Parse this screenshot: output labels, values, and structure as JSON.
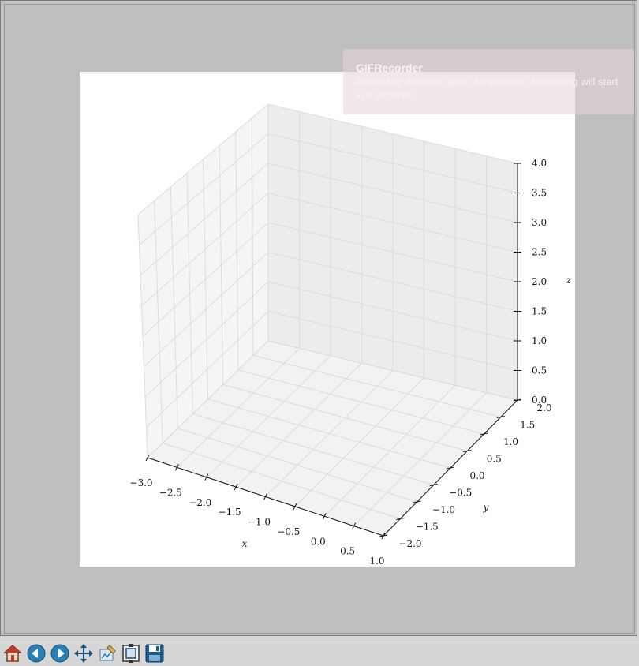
{
  "toolbar": {
    "buttons": [
      {
        "name": "home-button",
        "icon": "home-icon"
      },
      {
        "name": "back-button",
        "icon": "left-arrow-icon"
      },
      {
        "name": "forward-button",
        "icon": "right-arrow-icon"
      },
      {
        "name": "pan-button",
        "icon": "move-arrows-icon"
      },
      {
        "name": "edit-axes-button",
        "icon": "edit-icon"
      },
      {
        "name": "configure-subplots-button",
        "icon": "subplots-icon"
      },
      {
        "name": "save-button",
        "icon": "floppy-disk-icon"
      }
    ]
  },
  "toast": {
    "title": "GIFRecorder",
    "message": "Recording duration set to 30 seconds. Recording will start in 0 seconds."
  },
  "chart_data": {
    "type": "scatter",
    "projection": "3d",
    "series": [],
    "xlabel": "x",
    "ylabel": "y",
    "zlabel": "z",
    "xlim": [
      -3.0,
      1.0
    ],
    "ylim": [
      -2.0,
      2.0
    ],
    "zlim": [
      0.0,
      4.0
    ],
    "x_ticks": [
      "−3.0",
      "−2.5",
      "−2.0",
      "−1.5",
      "−1.0",
      "−0.5",
      "0.0",
      "0.5",
      "1.0"
    ],
    "y_ticks": [
      "−2.0",
      "−1.5",
      "−1.0",
      "−0.5",
      "0.0",
      "0.5",
      "1.0",
      "1.5",
      "2.0"
    ],
    "z_ticks": [
      "0.0",
      "0.5",
      "1.0",
      "1.5",
      "2.0",
      "2.5",
      "3.0",
      "3.5",
      "4.0"
    ],
    "grid": true
  }
}
